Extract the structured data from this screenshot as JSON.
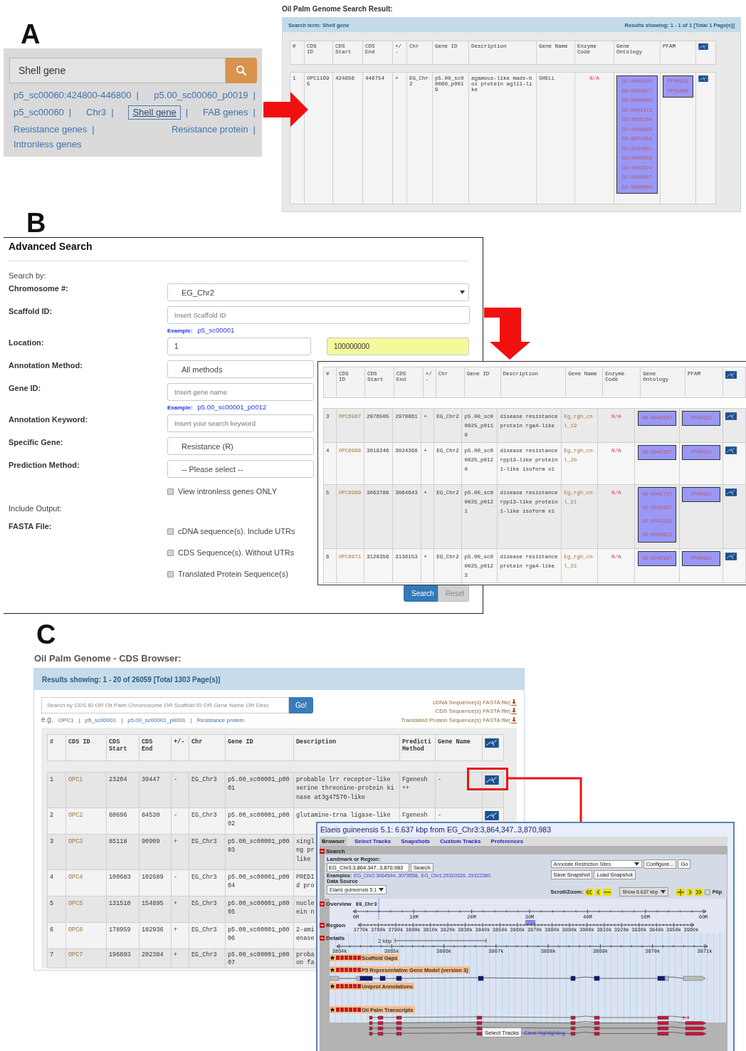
{
  "panel_a": {
    "letter": "A",
    "search": {
      "value": "Shell gene"
    },
    "link_lines": [
      [
        {
          "text": "p5_sc00060:424800-446800",
          "sep": "|",
          "selected": false
        },
        {
          "text": "p5.00_sc00060_p0019",
          "sep": "|",
          "selected": false
        }
      ],
      [
        {
          "text": "p5_sc00060",
          "sep": "|",
          "selected": false
        },
        {
          "text": "Chr3",
          "sep": "|",
          "selected": false
        },
        {
          "text": "Shell gene",
          "sep": "|",
          "selected": true
        },
        {
          "text": "FAB genes",
          "sep": "|",
          "selected": false
        }
      ],
      [
        {
          "text": "Resistance genes",
          "sep": "|",
          "selected": false
        },
        {
          "text": "Resistance protein",
          "sep": "|",
          "selected": false
        }
      ],
      [
        {
          "text": "Intronless genes",
          "selected": false
        }
      ]
    ],
    "result": {
      "title": "Oil Palm Genome Search Result:",
      "search_term": "Search term: Shell gene",
      "results_showing": "Results showing: 1 - 1 of 1 [Total 1 Page(s)]",
      "table": {
        "columns": [
          {
            "label": "#",
            "kind": "text"
          },
          {
            "label": "CDS ID",
            "kind": "text"
          },
          {
            "label": "CDS Start",
            "kind": "text"
          },
          {
            "label": "CDS End",
            "kind": "text"
          },
          {
            "label": "+/-",
            "kind": "text"
          },
          {
            "label": "Chr",
            "kind": "text"
          },
          {
            "label": "Gene ID",
            "kind": "text"
          },
          {
            "label": "Description",
            "kind": "text"
          },
          {
            "label": "Gene Name",
            "kind": "text"
          },
          {
            "label": "Enzyme Code",
            "kind": "na"
          },
          {
            "label": "Gene Ontology",
            "kind": "tags"
          },
          {
            "label": "PFAM",
            "kind": "tags"
          },
          {
            "kind": "icon"
          }
        ],
        "rows": [
          {
            "cells": [
              "1",
              "OPC11695",
              "424856",
              "446754",
              "+",
              "EG_Chr2",
              "p5.00_sc00060_p0019",
              "agamous-like mads-box protein agl11-like",
              "SHELL",
              "N/A",
              [
                "GO:0005634",
                "GO:0003677",
                "GO:0000902",
                "GO:0001071",
                "GO:0030154",
                "GO:0048856",
                "GO:0071554",
                "GO:0034641",
                "GO:0009058",
                "GO:0003674",
                "GO:0040007",
                "GO:0000003"
              ],
              [
                "PF00319",
                "PF01486"
              ]
            ]
          }
        ]
      }
    }
  },
  "panel_b": {
    "letter": "B",
    "form": {
      "title": "Advanced Search",
      "search_by_label": "Search by:",
      "fields": [
        {
          "kind": "select",
          "label": "Chromosome #:",
          "value": "EG_Chr2"
        },
        {
          "kind": "input",
          "label": "Scaffold ID:",
          "placeholder": "Insert Scaffold ID",
          "example_label": "Example:",
          "example": "p5_sc00001"
        },
        {
          "kind": "range",
          "label": "Location:",
          "from": "1",
          "to": "100000000"
        },
        {
          "kind": "select",
          "label": "Annotation Method:",
          "value": "All methods"
        },
        {
          "kind": "input",
          "label": "Gene ID:",
          "placeholder": "Insert gene name",
          "example_label": "Example:",
          "example": "p5.00_sc00001_p0012"
        },
        {
          "kind": "input",
          "label": "Annotation Keyword:",
          "placeholder": "Insert your search keyword"
        },
        {
          "kind": "select",
          "label": "Specific Gene:",
          "value": "Resistance (R)"
        },
        {
          "kind": "select",
          "label": "Prediction Method:",
          "value": "-- Please select --"
        },
        {
          "kind": "checkbox",
          "label": "View intronless genes ONLY",
          "checked": false
        }
      ],
      "include_output_label": "Include Output:",
      "fasta_label": "FASTA File:",
      "fasta_options": [
        {
          "label": "cDNA sequence(s). Include UTRs",
          "checked": false
        },
        {
          "label": "CDS Sequence(s). Without UTRs",
          "checked": false
        },
        {
          "label": "Translated Protein Sequence(s)",
          "checked": false
        }
      ],
      "buttons": [
        {
          "label": "Search",
          "disabled": false
        },
        {
          "label": "Reset",
          "disabled": true
        }
      ]
    },
    "result_table": {
      "columns": [
        {
          "label": "#",
          "kind": "text"
        },
        {
          "label": "CDS ID",
          "kind": "link"
        },
        {
          "label": "CDS Start",
          "kind": "text"
        },
        {
          "label": "CDS End",
          "kind": "text"
        },
        {
          "label": "+/-",
          "kind": "text"
        },
        {
          "label": "Chr",
          "kind": "text"
        },
        {
          "label": "Gene ID",
          "kind": "text"
        },
        {
          "label": "Description",
          "kind": "text"
        },
        {
          "label": "Gene Name",
          "kind": "link"
        },
        {
          "label": "Enzyme Code",
          "kind": "na"
        },
        {
          "label": "Gene Ontology",
          "kind": "tags"
        },
        {
          "label": "PFAM",
          "kind": "tags"
        },
        {
          "kind": "icon"
        }
      ],
      "rows": [
        {
          "cells": [
            "3",
            "OPC6967",
            "2976505",
            "2978861",
            "+",
            "EG_Chr2",
            "p5.00_sc00025_p0119",
            "disease resistance protein rga4-like",
            "Eg_rgh_cnl_19",
            "N/A",
            [
              "GO:0043167"
            ],
            [
              "PF00931"
            ]
          ]
        },
        {
          "cells": [
            "4",
            "OPC6968",
            "3018246",
            "3024368",
            "+",
            "EG_Chr2",
            "p5.00_sc00025_p0120",
            "disease resistance rpp13-like protein 1-like isoform x1",
            "Eg_rgh_cnl_20",
            "N/A",
            [
              "GO:0043167"
            ],
            [
              "PF00931"
            ]
          ]
        },
        {
          "cells": [
            "5",
            "OPC6969",
            "3063786",
            "3064643",
            "+",
            "EG_Chr2",
            "p5.00_sc00025_p0121",
            "disease resistance rpp13-like protein 1-like isoform x1",
            "Eg_rgh_cnl_21",
            "N/A",
            [
              "GO:0005737",
              "GO:0043167",
              "GO:0043226",
              "GO:0005622"
            ],
            [
              "PF00931"
            ]
          ]
        },
        {
          "cells": [
            "6",
            "OPC6971",
            "3128356",
            "3136153",
            "+",
            "EG_Chr2",
            "p5.00_sc00025_p0123",
            "disease resistance protein rga4-like",
            "Eg_rgh_cnl_22",
            "N/A",
            [
              "GO:0043167"
            ],
            [
              "PF00931"
            ]
          ]
        }
      ]
    }
  },
  "panel_c": {
    "letter": "C",
    "title": "Oil Palm Genome - CDS Browser:",
    "results_showing": "Results showing: 1 - 20 of 26059 [Total 1303 Page(s)]",
    "search": {
      "placeholder": "Search by CDS ID OR Oil Palm Chromosome OR Scaffold ID OR Gene Name OR Desc",
      "button": "Go!"
    },
    "eg_label": "e.g.",
    "examples": [
      {
        "text": "OPC1",
        "sep": "|"
      },
      {
        "text": "p5_sc00001",
        "sep": "|"
      },
      {
        "text": "p5.00_sc00001_p0001",
        "sep": "|"
      },
      {
        "text": "Resistance protein"
      }
    ],
    "downloads": [
      "cDNA Sequence(s) FASTA file|",
      "CDS Sequence(s) FASTA file|",
      "Translated Protein Sequence(s) FASTA file|"
    ],
    "table": {
      "columns": [
        {
          "label": "#",
          "kind": "text"
        },
        {
          "label": "CDS ID",
          "kind": "link"
        },
        {
          "label": "CDS Start",
          "kind": "text"
        },
        {
          "label": "CDS End",
          "kind": "text"
        },
        {
          "label": "+/-",
          "kind": "text"
        },
        {
          "label": "Chr",
          "kind": "text"
        },
        {
          "label": "Gene ID",
          "kind": "text"
        },
        {
          "label": "Description",
          "kind": "text"
        },
        {
          "label": "Predicti Method",
          "kind": "text"
        },
        {
          "label": "Gene Name",
          "kind": "text"
        },
        {
          "kind": "icon"
        }
      ],
      "rows": [
        {
          "cells": [
            "1",
            "OPC1",
            "23204",
            "39447",
            "-",
            "EG_Chr3",
            "p5.00_sc00001_p0001",
            "probable lrr receptor-like serine threonine-protein kinase at3g47570-like",
            "Fgenesh ++",
            "-"
          ]
        },
        {
          "cells": [
            "2",
            "OPC2",
            "60696",
            "84530",
            "-",
            "EG_Chr3",
            "p5.00_sc00001_p0002",
            "glutamine-trna ligase-like",
            "Fgenesh",
            "-"
          ]
        },
        {
          "cells": [
            "3",
            "OPC3",
            "85118",
            "90909",
            "+",
            "EG_Chr3",
            "p5.00_sc00001_p0003",
            "singl\nng pr\nlike"
          ]
        },
        {
          "cells": [
            "4",
            "OPC4",
            "100683",
            "102689",
            "-",
            "EG_Chr3",
            "p5.00_sc00001_p0004",
            "PREDI\nd pro"
          ]
        },
        {
          "cells": [
            "5",
            "OPC5",
            "131510",
            "154895",
            "+",
            "EG_Chr3",
            "p5.00_sc00001_p0005",
            "nucle\nein n"
          ]
        },
        {
          "cells": [
            "6",
            "OPC6",
            "178959",
            "182936",
            "+",
            "EG_Chr3",
            "p5.00_sc00001_p0006",
            "2-ami\nenase"
          ]
        },
        {
          "cells": [
            "7",
            "OPC7",
            "196893",
            "202384",
            "+",
            "EG_Chr3",
            "p5.00_sc00001_p0007",
            "proba\non fa"
          ]
        }
      ]
    },
    "browser": {
      "title": "Elaeis guineensis 5.1: 6.637 kbp from EG_Chr3:3,864,347..3,870,983",
      "tabs": [
        {
          "label": "Browser",
          "selected": true
        },
        {
          "label": "Select Tracks",
          "selected": false
        },
        {
          "label": "Snapshots",
          "selected": false
        },
        {
          "label": "Custom Tracks",
          "selected": false
        },
        {
          "label": "Preferences",
          "selected": false
        }
      ],
      "search_section": {
        "title": "Search",
        "landmark_label": "Landmark or Region:",
        "landmark_value": "EG_Chr3:3,864,347..3,870,983",
        "search_button": "Search",
        "examples_label": "Examples:",
        "examples": [
          "EG_Chr2:3064544..3079558,",
          "EG_Chr1:29320326..29322380."
        ],
        "data_source_label": "Data Source",
        "data_source": "Elaeis guineensis 5.1",
        "plugin": "Annotate Restriction Sites",
        "configure_button": "Configure...",
        "go_button": "Go",
        "save_button": "Save Snapshot",
        "load_button": "Load Snapshot",
        "scroll_label": "Scroll/Zoom:",
        "zoom": "Show 6.637 kbp",
        "flip_label": "Flip",
        "flip": false
      },
      "overview": {
        "title": "Overview",
        "chromosome": "EG_Chr3",
        "ticks": [
          "0M",
          "10M",
          "20M",
          "30M",
          "40M",
          "50M",
          "60M"
        ]
      },
      "region": {
        "title": "Region",
        "ticks": [
          "3770k",
          "3780k",
          "3790k",
          "3800k",
          "3810k",
          "3820k",
          "3830k",
          "3840k",
          "3850k",
          "3860k",
          "3870k",
          "3880k",
          "3890k",
          "3900k",
          "3910k",
          "3920k",
          "3930k",
          "3940k",
          "3950k",
          "3960k"
        ]
      },
      "details": {
        "title": "Details",
        "scale": "2 kbp",
        "ticks": [
          "3864k",
          "3865k",
          "3866k",
          "3867k",
          "3868k",
          "3869k",
          "3870k",
          "3871k"
        ],
        "tracks": [
          {
            "name": "Scaffold Gaps",
            "kind": "gaps"
          },
          {
            "name": "P5 Representative Gene Model (version 3)",
            "kind": "gene_model"
          },
          {
            "name": "Uniprot Annotations",
            "kind": "empty"
          },
          {
            "name": "Oil Palm Transcripts",
            "kind": "transcripts"
          }
        ]
      },
      "select_tracks_button": "Select Tracks",
      "clear_link": "Clear highlighting"
    }
  }
}
